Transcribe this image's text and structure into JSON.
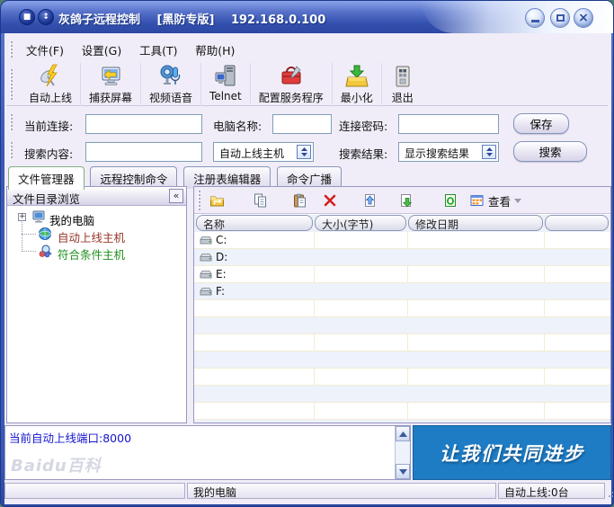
{
  "window": {
    "title": "灰鸽子远程控制",
    "edition": "[黑防专版]",
    "ip": "192.168.0.100"
  },
  "menu_bar": {
    "items": [
      {
        "label": "文件(F)"
      },
      {
        "label": "设置(G)"
      },
      {
        "label": "工具(T)"
      },
      {
        "label": "帮助(H)"
      }
    ]
  },
  "toolbar": {
    "buttons": [
      {
        "label": "自动上线",
        "icon": "satellite-online-icon"
      },
      {
        "label": "捕获屏幕",
        "icon": "capture-screen-icon"
      },
      {
        "label": "视频语音",
        "icon": "video-voice-icon"
      },
      {
        "label": "Telnet",
        "icon": "telnet-icon"
      },
      {
        "label": "配置服务程序",
        "icon": "configure-service-icon"
      },
      {
        "label": "最小化",
        "icon": "minimize-to-tray-icon"
      },
      {
        "label": "退出",
        "icon": "exit-icon"
      }
    ]
  },
  "connection_bar": {
    "current_connection_label": "当前连接:",
    "current_connection_value": "",
    "computer_name_label": "电脑名称:",
    "computer_name_value": "",
    "password_label": "连接密码:",
    "password_value": "",
    "save_button": "保存"
  },
  "search_bar": {
    "content_label": "搜索内容:",
    "content_value": "",
    "host_dropdown_value": "自动上线主机",
    "result_label": "搜索结果:",
    "result_dropdown_value": "显示搜索结果",
    "search_button": "搜索"
  },
  "tabs": [
    {
      "label": "文件管理器",
      "active": true
    },
    {
      "label": "远程控制命令",
      "active": false
    },
    {
      "label": "注册表编辑器",
      "active": false
    },
    {
      "label": "命令广播",
      "active": false
    }
  ],
  "tree_panel": {
    "header": "文件目录浏览",
    "collapse_glyph": "«",
    "expander_glyph": "+",
    "items": [
      {
        "label": "我的电脑",
        "icon": "my-computer-icon",
        "color": "#000000"
      },
      {
        "label": "自动上线主机",
        "icon": "online-hosts-globe-icon",
        "color": "#9a3528"
      },
      {
        "label": "符合条件主机",
        "icon": "matched-hosts-search-icon",
        "color": "#1d8f1d"
      }
    ]
  },
  "file_panel": {
    "tool_icons": [
      {
        "icon": "parent-folder-icon"
      },
      {
        "icon": "copy-icon"
      },
      {
        "icon": "paste-icon"
      },
      {
        "icon": "delete-icon"
      },
      {
        "icon": "upload-file-icon"
      },
      {
        "icon": "download-file-icon"
      },
      {
        "icon": "refresh-icon"
      }
    ],
    "view_button": "查看",
    "columns": [
      {
        "label": "名称"
      },
      {
        "label": "大小(字节)"
      },
      {
        "label": "修改日期"
      },
      {
        "label": ""
      }
    ],
    "rows": [
      {
        "name": "C:"
      },
      {
        "name": "D:"
      },
      {
        "name": "E:"
      },
      {
        "name": "F:"
      }
    ]
  },
  "log_panel": {
    "line1": "当前自动上线端口:8000"
  },
  "banner": {
    "text": "让我们共同进步",
    "bg_color": "#1e7cc4"
  },
  "status_bar": {
    "center": "我的电脑",
    "right": "自动上线:0台"
  },
  "watermark": "Baidu百科",
  "colors": {
    "titlebar_top": "#8ba3e8",
    "titlebar_bottom": "#2c48a4",
    "client_bg": "#f0edf8",
    "control_border": "#7f9db9",
    "banner_blue": "#1e7cc4",
    "log_text_blue": "#1414cc",
    "online_host_red": "#9a3528",
    "matched_host_green": "#1d8f1d",
    "row_alt_blue": "#edf2fb",
    "gridline_yellow": "#f1ecd2"
  }
}
